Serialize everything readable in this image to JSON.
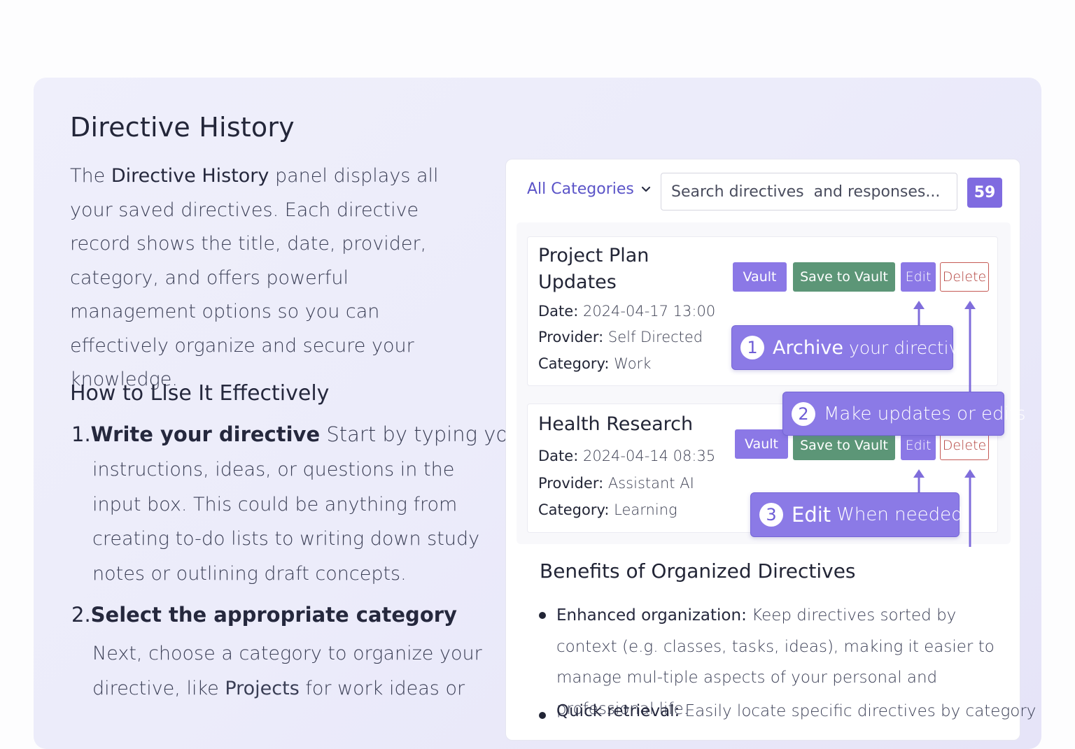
{
  "page": {
    "title": "Directive History",
    "intro": {
      "p1": "The ",
      "strong": "Directive History",
      "p2": " panel displays all your saved directives. Each directive record shows the title, date, provider, category, and offers powerful management options so you can effectively organize and secure your knowledge."
    },
    "howto_title": "How to Llse It Effectively",
    "steps": [
      {
        "num": "1.",
        "title": "Write your directive",
        "title_rest": " Start by typing your",
        "body": "instructions, ideas, or questions in the input box. This could be anything from creating to-do lists to writing down study notes or outlining draft concepts."
      },
      {
        "num": "2.",
        "title": "Select the appropriate category",
        "body_pre": "Next, choose a category to organize your directive, like ",
        "body_strong": "Projects",
        "body_post": " for work ideas or"
      }
    ]
  },
  "toolbar": {
    "category_label": "All Categories",
    "search_placeholder": "Search directives  and responses...",
    "count": "59"
  },
  "labels": {
    "date": "Date",
    "provider": "Provider",
    "category": "Category"
  },
  "records": [
    {
      "title_line1": "Project Plan",
      "title_line2": "Updates",
      "date": "2024-04-17 13:00",
      "provider": "Self Directed",
      "category": "Work"
    },
    {
      "title": "Health Research",
      "date": "2024-04-14 08:35",
      "provider": "Assistant AI",
      "category": "Learning"
    }
  ],
  "buttons": {
    "vault": "Vault",
    "save": "Save to Vault",
    "edit": "Edit",
    "delete": "Delete"
  },
  "callouts": [
    {
      "num": "1",
      "strong": "Archive",
      "light": "your directive"
    },
    {
      "num": "2",
      "strong": "",
      "light": "Make updates or edits"
    },
    {
      "num": "3",
      "strong": "Edit",
      "light": "When needed"
    }
  ],
  "benefits": {
    "title": "Benefits of Organized Directives",
    "item1_strong": "Enhanced organization:",
    "item1_text": " Keep directives sorted by context (e.g. classes, tasks, ideas), making it easier to manage mul-tiple aspects of your personal and professional life.",
    "item2_strong": "Quick retrieval:",
    "item2_text": " Easily locate specific directives by category"
  },
  "icons": {
    "dropdown": "chevron-down-icon",
    "arrow": "arrow-up-icon"
  },
  "colors": {
    "accent": "#8b78e6",
    "save_green": "#5c9677",
    "delete_red": "#b3423e",
    "category_link": "#5b54c8"
  }
}
